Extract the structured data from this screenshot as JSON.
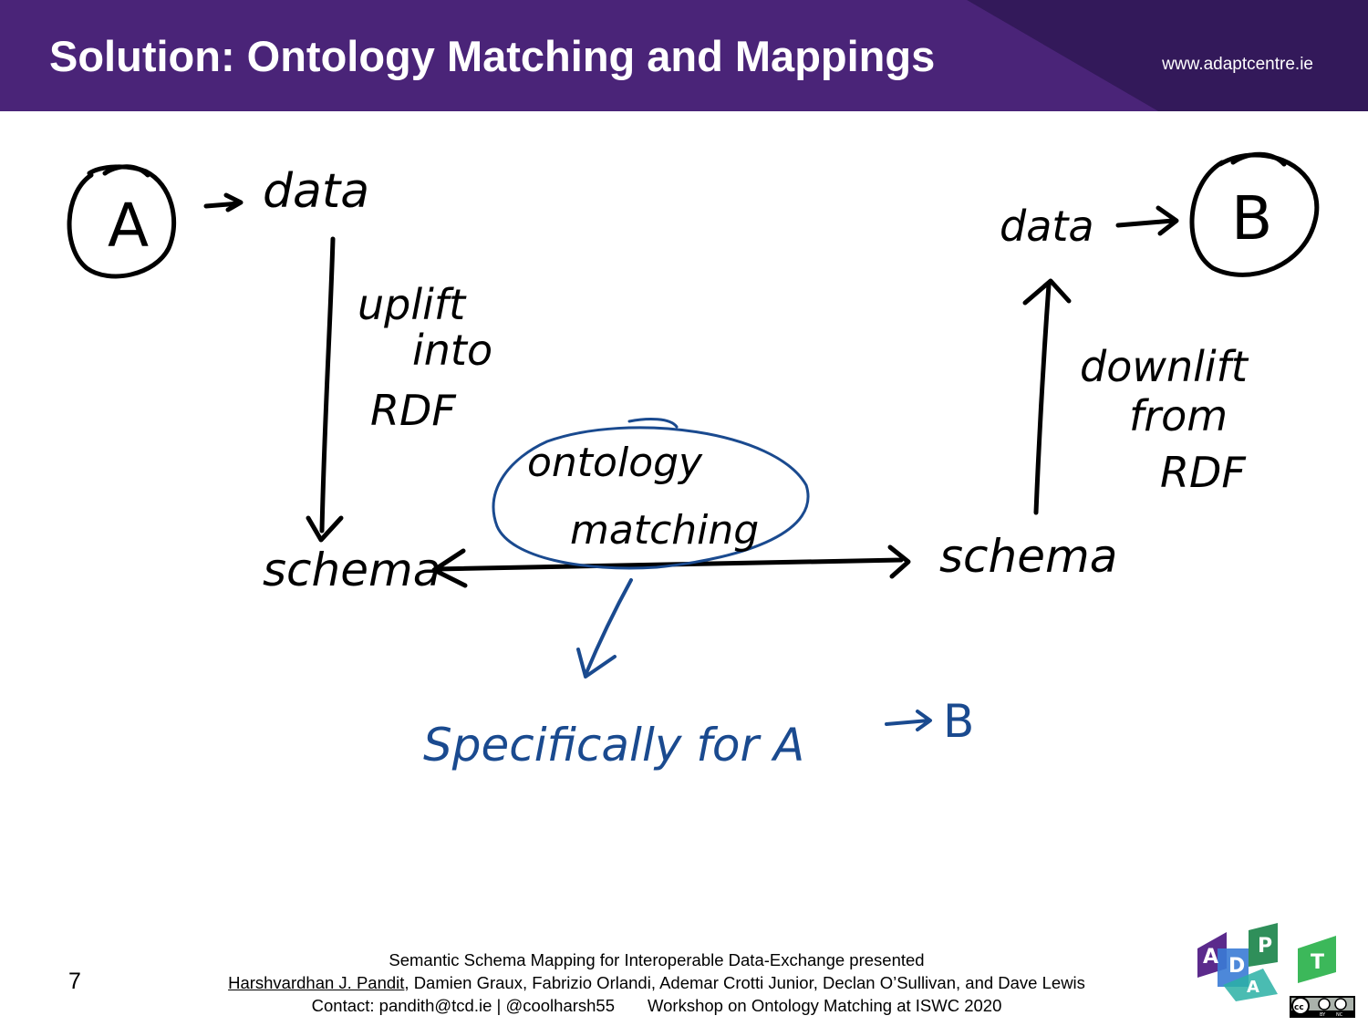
{
  "header": {
    "title": "Solution: Ontology Matching and Mappings",
    "website": "www.adaptcentre.ie"
  },
  "diagram": {
    "node_a": "A",
    "node_b": "B",
    "data_left": "data",
    "data_right": "data",
    "uplift": [
      "uplift",
      "into",
      "RDF"
    ],
    "downlift": [
      "downlift",
      "from",
      "RDF"
    ],
    "schema_left": "schema",
    "schema_right": "schema",
    "matching": [
      "ontology",
      "matching"
    ],
    "specifically": "Specifically for A",
    "specifically_target": "B"
  },
  "footer": {
    "page_number": "7",
    "line1": "Semantic Schema Mapping for Interoperable Data-Exchange presented",
    "author_link": "Harshvardhan J. Pandit",
    "authors_rest": ", Damien Graux, Fabrizio Orlandi, Ademar Crotti Junior, Declan O’Sullivan, and Dave Lewis",
    "contact": "Contact: pandith@tcd.ie | @coolharsh55",
    "workshop": "Workshop on Ontology Matching at ISWC 2020"
  },
  "logo": {
    "letters": [
      "A",
      "D",
      "P",
      "A",
      "T"
    ],
    "license_badge": "cc by nc",
    "license_icon": "creative-commons-icon"
  },
  "colors": {
    "header": "#4a2478",
    "ink_black": "#000000",
    "ink_blue": "#1a4a8f",
    "logo_purple": "#5b2a8c",
    "logo_blue": "#3a7bd5",
    "logo_green": "#3cb85a",
    "logo_teal": "#2ab0a4"
  }
}
